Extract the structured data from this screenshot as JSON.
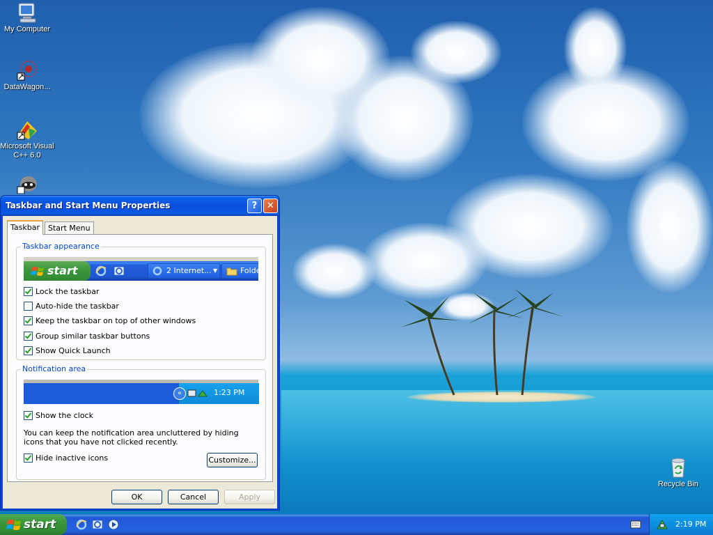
{
  "desktop": {
    "icons": [
      {
        "label": "My Computer"
      },
      {
        "label": "DataWagon..."
      },
      {
        "label": "Microsoft Visual C++ 6.0"
      },
      {
        "label": ""
      },
      {
        "label": "Recycle Bin"
      }
    ]
  },
  "dialog": {
    "title": "Taskbar and Start Menu Properties",
    "help_label": "?",
    "close_label": "✕",
    "tabs": [
      {
        "label": "Taskbar",
        "selected": true
      },
      {
        "label": "Start Menu",
        "selected": false
      }
    ],
    "appearance": {
      "title": "Taskbar appearance",
      "preview": {
        "start_label": "start",
        "button1": "2 Internet...",
        "button2": "Folde"
      },
      "options": [
        {
          "label": "Lock the taskbar",
          "checked": true
        },
        {
          "label": "Auto-hide the taskbar",
          "checked": false
        },
        {
          "label": "Keep the taskbar on top of other windows",
          "checked": true
        },
        {
          "label": "Group similar taskbar buttons",
          "checked": true
        },
        {
          "label": "Show Quick Launch",
          "checked": true
        }
      ]
    },
    "notification": {
      "title": "Notification area",
      "preview_time": "1:23 PM",
      "show_clock": {
        "label": "Show the clock",
        "checked": true
      },
      "description": "You can keep the notification area uncluttered by hiding icons that you have not clicked recently.",
      "hide_inactive": {
        "label": "Hide inactive icons",
        "checked": true
      },
      "customize_label": "Customize..."
    },
    "buttons": {
      "ok": "OK",
      "cancel": "Cancel",
      "apply": "Apply"
    }
  },
  "taskbar": {
    "start_label": "start",
    "clock": "2:19 PM"
  },
  "colors": {
    "xp_blue": "#245edb",
    "start_green": "#3c9a3d",
    "groupbox_title": "#0046d5"
  }
}
